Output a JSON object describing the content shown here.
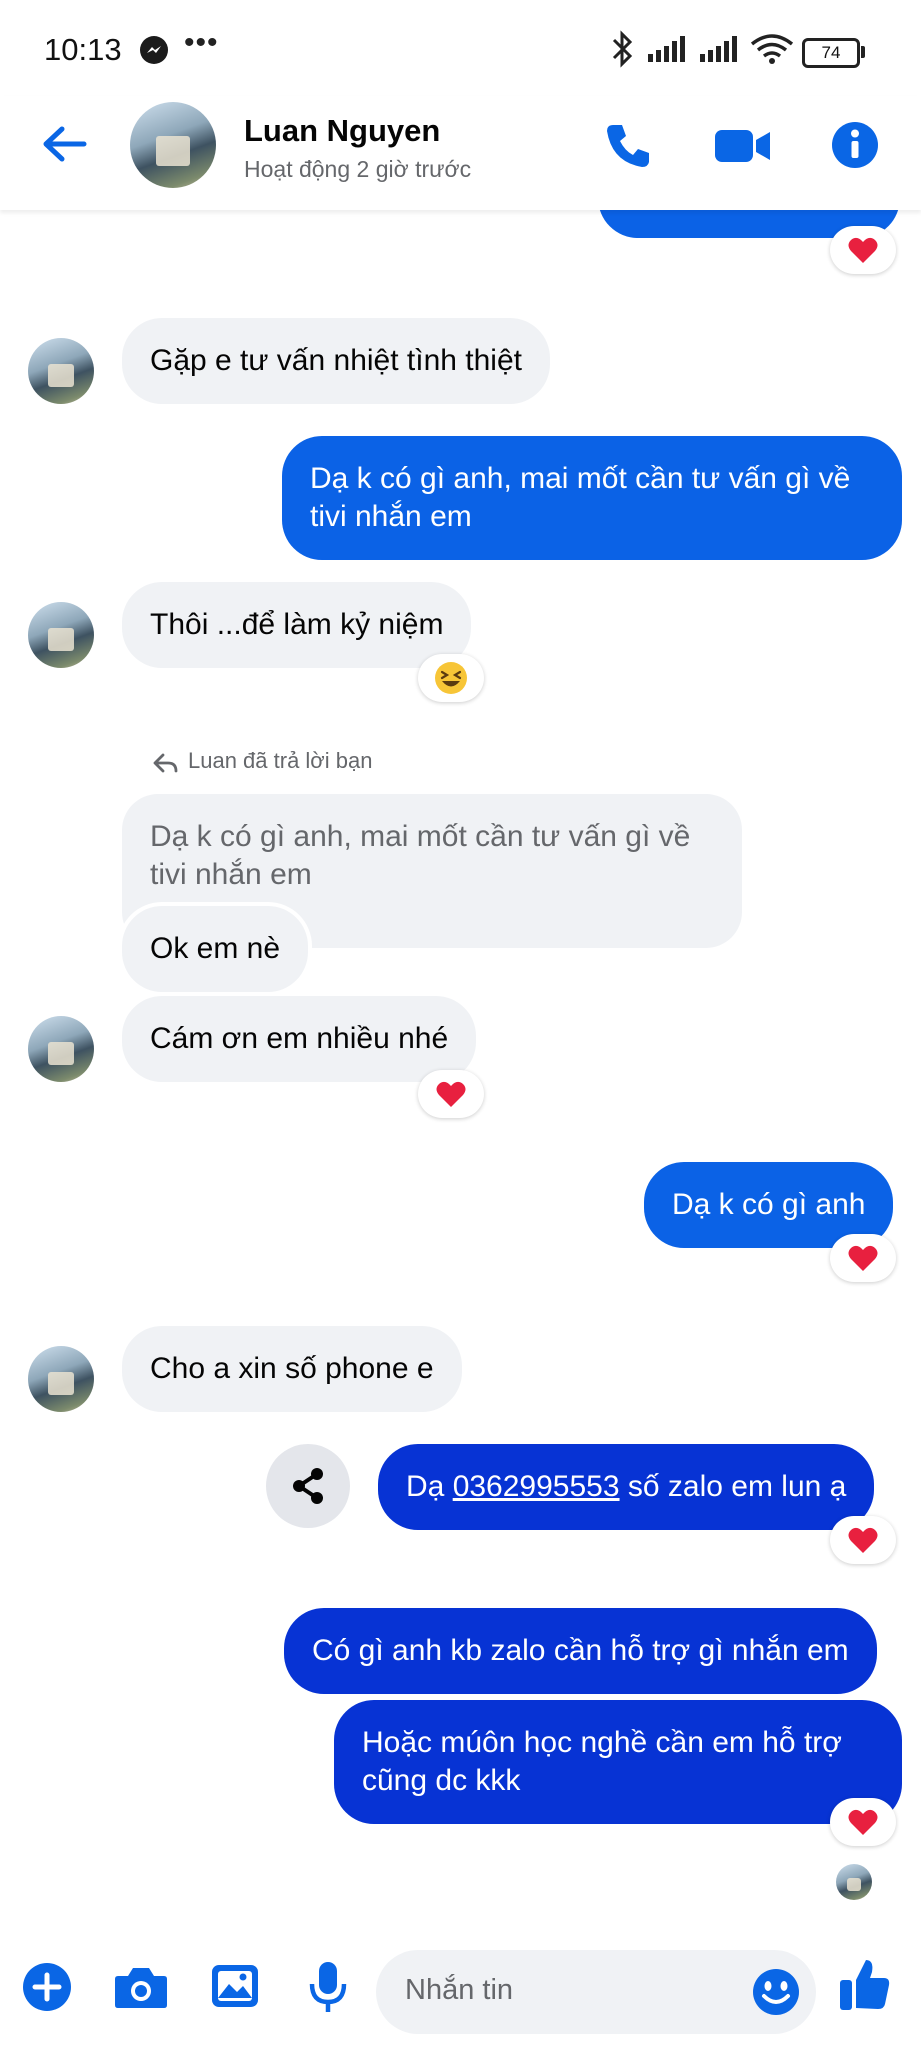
{
  "status_bar": {
    "time": "10:13",
    "dots": "•••",
    "battery": "74"
  },
  "header": {
    "contact_name": "Luan Nguyen",
    "contact_status": "Hoạt động 2 giờ trước"
  },
  "messages": [
    {
      "from": "them",
      "text": "Gặp e tư vấn nhiệt tình thiệt"
    },
    {
      "from": "me",
      "line1": "Dạ k có gì anh, mai mốt cần tư vấn gì về",
      "line2": "tivi nhắn em"
    },
    {
      "from": "them",
      "text": "Thôi ...để làm kỷ niệm",
      "reaction": "laugh"
    },
    {
      "reply_label": "Luan đã trả lời bạn",
      "quoted_line1": "Dạ k có gì anh, mai mốt cần tư vấn gì về",
      "quoted_line2": "tivi nhắn em",
      "text": "Ok em nè"
    },
    {
      "from": "them",
      "text": "Cám ơn em nhiều nhé",
      "reaction": "heart"
    },
    {
      "from": "me",
      "text": "Dạ k có gì anh",
      "reaction": "heart"
    },
    {
      "from": "them",
      "text": "Cho a xin số phone e"
    },
    {
      "from": "me",
      "prefix": "Dạ ",
      "phone": "0362995553",
      "suffix": " số zalo em lun ạ",
      "reaction": "heart"
    },
    {
      "from": "me",
      "text": "Có gì anh kb zalo cần hỗ trợ gì nhắn em"
    },
    {
      "from": "me",
      "line1": "Hoặc múôn học nghề cần em hỗ trợ",
      "line2": "cũng dc kkk",
      "reaction": "heart"
    }
  ],
  "composer": {
    "placeholder": "Nhắn tin"
  },
  "colors": {
    "accent": "#0b62e6",
    "sent_dark": "#0733d4",
    "received": "#f0f2f5",
    "heart": "#e8203f"
  }
}
